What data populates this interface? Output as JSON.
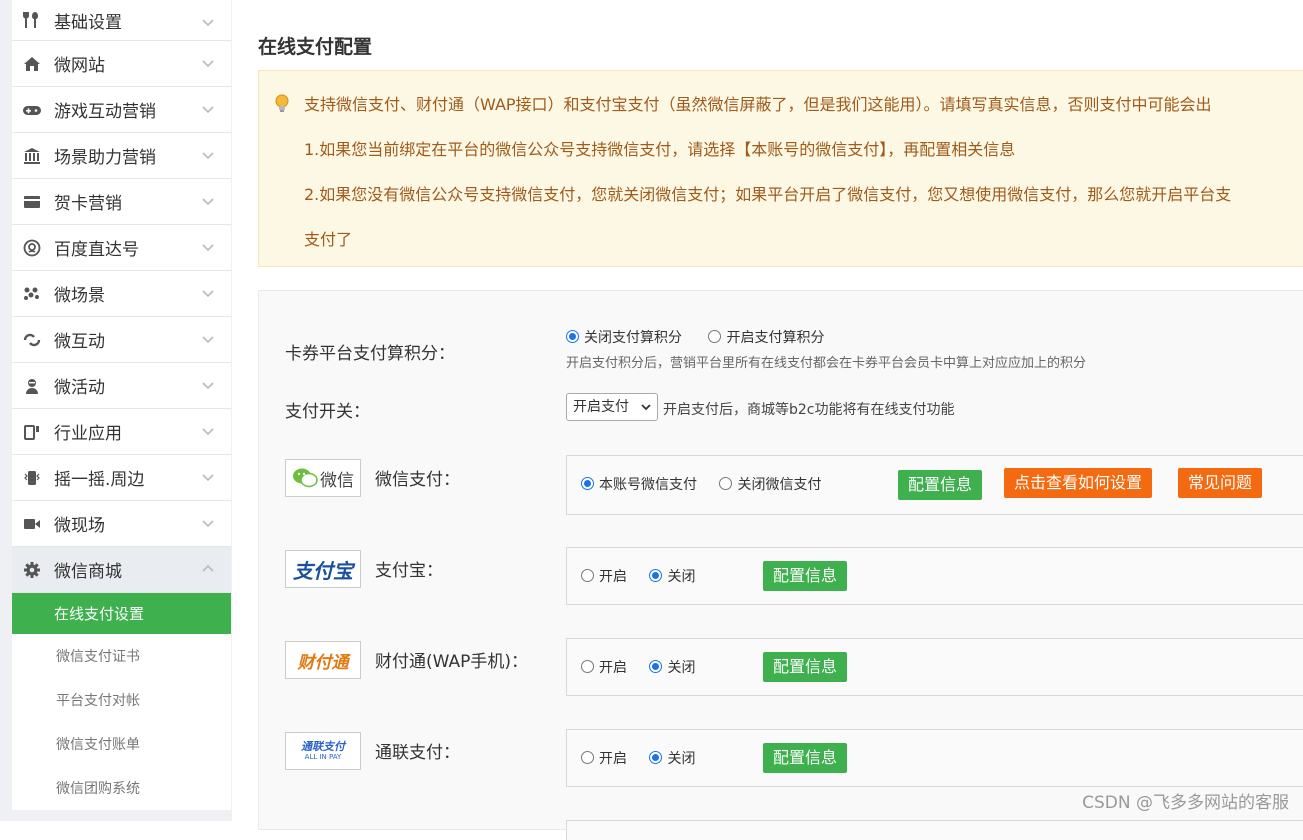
{
  "sidebar": {
    "items": [
      {
        "label": "基础设置",
        "icon": "tools-icon"
      },
      {
        "label": "微网站",
        "icon": "home-icon"
      },
      {
        "label": "游戏互动营销",
        "icon": "gamepad-icon"
      },
      {
        "label": "场景助力营销",
        "icon": "bank-icon"
      },
      {
        "label": "贺卡营销",
        "icon": "card-icon"
      },
      {
        "label": "百度直达号",
        "icon": "at-icon"
      },
      {
        "label": "微场景",
        "icon": "dots-icon"
      },
      {
        "label": "微互动",
        "icon": "interact-icon"
      },
      {
        "label": "微活动",
        "icon": "activity-icon"
      },
      {
        "label": "行业应用",
        "icon": "industry-icon"
      },
      {
        "label": "摇一摇.周边",
        "icon": "shake-icon"
      },
      {
        "label": "微现场",
        "icon": "video-icon"
      },
      {
        "label": "微信商城",
        "icon": "gear-icon"
      }
    ],
    "subitems": [
      {
        "label": "在线支付设置",
        "active": true
      },
      {
        "label": "微信支付证书",
        "active": false
      },
      {
        "label": "平台支付对帐",
        "active": false
      },
      {
        "label": "微信支付账单",
        "active": false
      },
      {
        "label": "微信团购系统",
        "active": false
      }
    ]
  },
  "main": {
    "title": "在线支付配置",
    "notice": {
      "line1": "支持微信支付、财付通（WAP接口）和支付宝支付（虽然微信屏蔽了，但是我们这能用）。请填写真实信息，否则支付中可能会出",
      "line2": "1.如果您当前绑定在平台的微信公众号支持微信支付，请选择【本账号的微信支付】，再配置相关信息",
      "line3": "2.如果您没有微信公众号支持微信支付，您就关闭微信支付；如果平台开启了微信支付，您又想使用微信支付，那么您就开启平台支",
      "line4": "支付了"
    },
    "points": {
      "label": "卡券平台支付算积分：",
      "option_off": "关闭支付算积分",
      "option_on": "开启支付算积分",
      "selected": "off",
      "hint": "开启支付积分后，营销平台里所有在线支付都会在卡券平台会员卡中算上对应应加上的积分"
    },
    "switch": {
      "label": "支付开关：",
      "value": "开启支付",
      "hint": "开启支付后，商城等b2c功能将有在线支付功能"
    },
    "wechat": {
      "logo_text": "微信",
      "label": "微信支付：",
      "option_own": "本账号微信支付",
      "option_off": "关闭微信支付",
      "btn_config": "配置信息",
      "btn_howto": "点击查看如何设置",
      "btn_faq": "常见问题"
    },
    "alipay": {
      "logo_text": "支付宝",
      "label": "支付宝：",
      "option_on": "开启",
      "option_off": "关闭",
      "btn_config": "配置信息"
    },
    "tenpay": {
      "logo_text": "财付通",
      "label": "财付通(WAP手机)：",
      "option_on": "开启",
      "option_off": "关闭",
      "btn_config": "配置信息"
    },
    "allinpay": {
      "logo_text": "通联支付",
      "logo_sub": "ALL IN PAY",
      "label": "通联支付：",
      "option_on": "开启",
      "option_off": "关闭",
      "btn_config": "配置信息"
    }
  },
  "watermark": "CSDN @飞多多网站的客服",
  "colors": {
    "accent_green": "#3eb04e",
    "accent_orange": "#f46a10",
    "notice_bg": "#fcf8e3",
    "notice_text": "#a05a1c"
  }
}
